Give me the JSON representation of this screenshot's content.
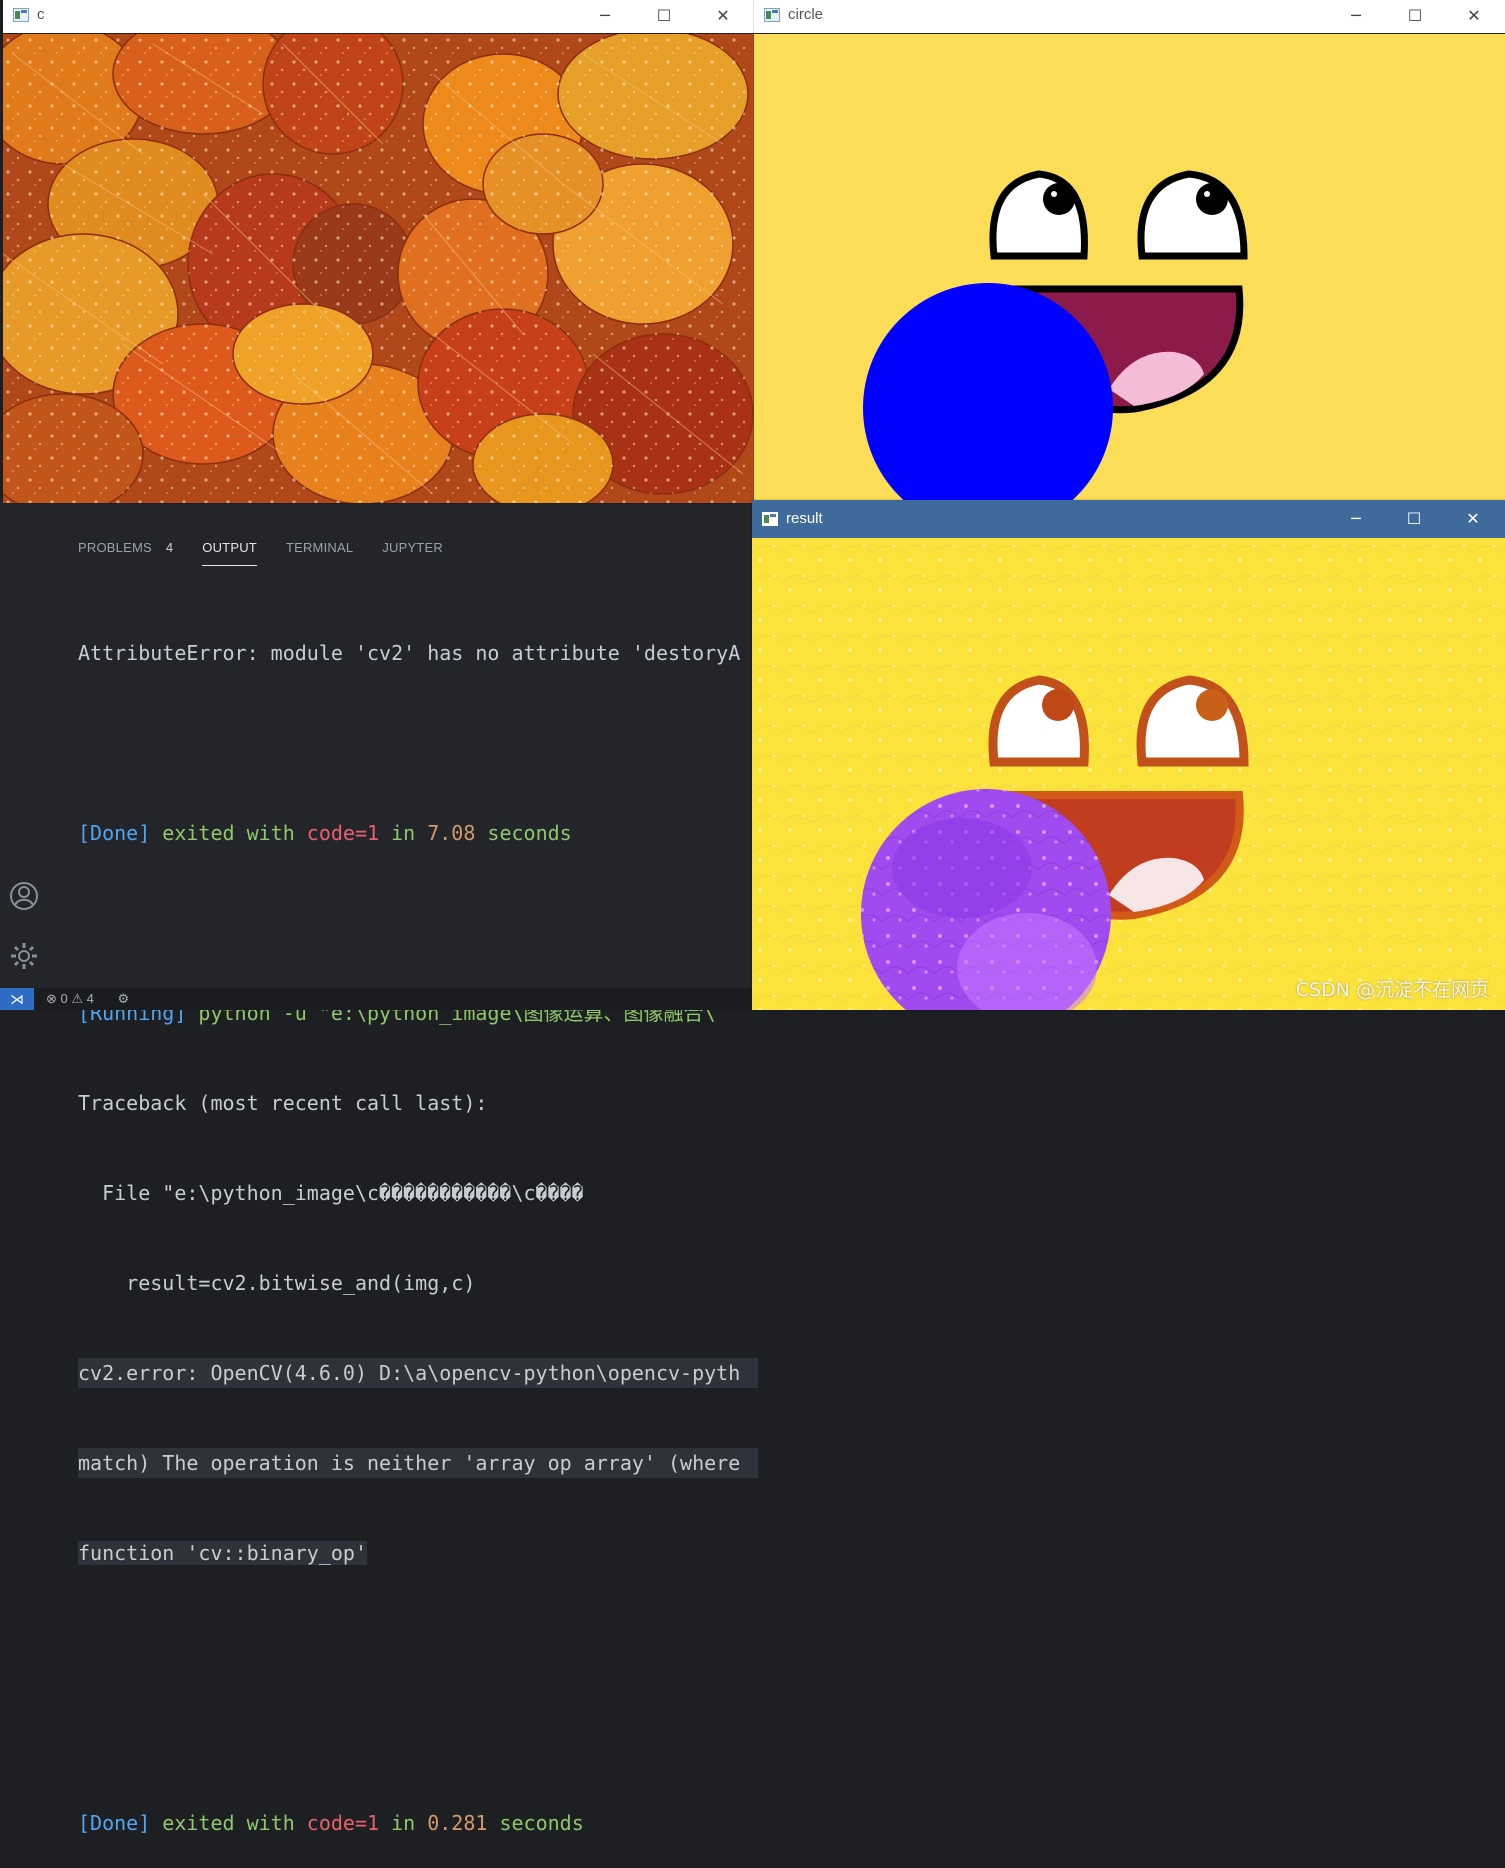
{
  "windows": {
    "c": {
      "title": "c"
    },
    "circle": {
      "title": "circle"
    },
    "result": {
      "title": "result",
      "watermark": "CSDN @沉淀不在网页"
    }
  },
  "panel": {
    "tabs": [
      {
        "label": "PROBLEMS",
        "count": "4"
      },
      {
        "label": "OUTPUT"
      },
      {
        "label": "TERMINAL"
      },
      {
        "label": "JUPYTER"
      }
    ],
    "active_tab": "OUTPUT"
  },
  "output": {
    "l1": "AttributeError: module 'cv2' has no attribute 'destoryA",
    "l2_done": "[Done]",
    "l2_exited": " exited with ",
    "l2_code": "code=1",
    "l2_in": " in ",
    "l2_time": "7.08",
    "l2_seconds": " seconds",
    "l3_running": "[Running]",
    "l3_cmd": " python -u \"e:\\python_image\\图像运算、图像融合\\",
    "l4": "Traceback (most recent call last):",
    "l5": "  File \"e:\\python_image\\c�����������\\c����",
    "l6": "    result=cv2.bitwise_and(img,c)",
    "l7": "cv2.error: OpenCV(4.6.0) D:\\a\\opencv-python\\opencv-pyth",
    "l8": "match) The operation is neither 'array op array' (where",
    "l9": "function 'cv::binary_op'",
    "l10_done": "[Done]",
    "l10_exited": " exited with ",
    "l10_code": "code=1",
    "l10_in": " in ",
    "l10_time": "0.281",
    "l10_seconds": " seconds"
  },
  "statusbar": {
    "errors": "0",
    "warnings": "4"
  },
  "colors": {
    "face_yellow": "#fbdd58",
    "blue_circle": "#0000ff",
    "mouth": "#8c1a4b",
    "tongue": "#f5bcd8",
    "title_focused": "#3e6b9c"
  }
}
